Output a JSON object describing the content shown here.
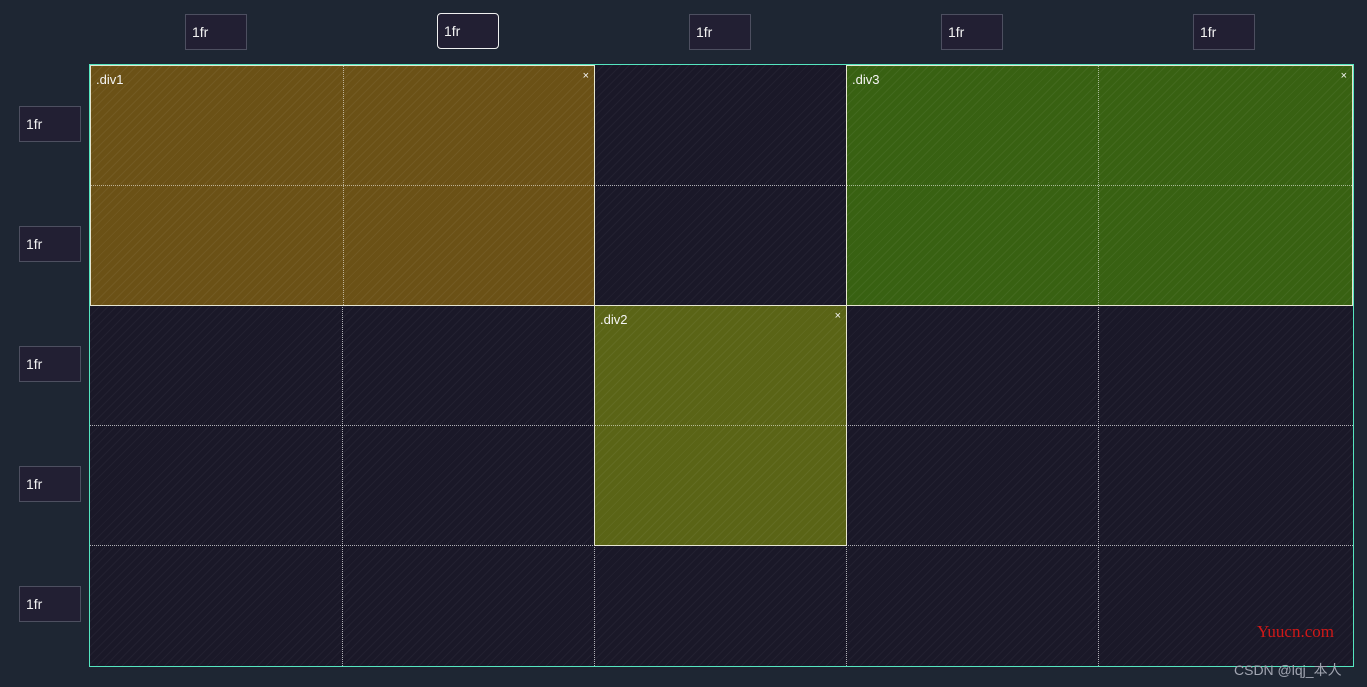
{
  "columns": [
    "1fr",
    "1fr",
    "1fr",
    "1fr",
    "1fr"
  ],
  "rows": [
    "1fr",
    "1fr",
    "1fr",
    "1fr",
    "1fr"
  ],
  "areas": {
    "div1": {
      "label": ".div1",
      "close": "×",
      "color": "#6b5116"
    },
    "div2": {
      "label": ".div2",
      "close": "×",
      "color": "#5a6416"
    },
    "div3": {
      "label": ".div3",
      "close": "×",
      "color": "#386112"
    }
  },
  "colors": {
    "page_background": "#1e2633",
    "grid_background": "#1a1828",
    "grid_border": "#55e6c0"
  },
  "watermarks": {
    "site": "Yuucn.com",
    "author": "CSDN @lqj_本人"
  }
}
